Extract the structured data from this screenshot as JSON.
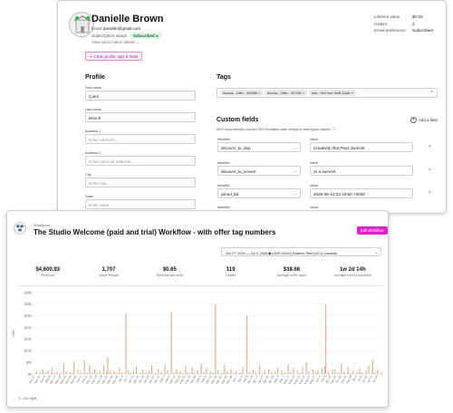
{
  "profile": {
    "name": "Danielle Brown",
    "email_label": "Email",
    "email": "danielle@gmail.com",
    "subscription_label": "Subscription status",
    "subscription_status": "Subscribed",
    "view_details": "View subscription details ⌄",
    "stats": [
      {
        "label": "Lifetime value",
        "value": "$0.00"
      },
      {
        "label": "Orders",
        "value": "2"
      },
      {
        "label": "Email preference",
        "value": "Subscribed"
      }
    ],
    "chip": "✦ Clean profile, tags & fields",
    "profile_title": "Profile",
    "fields": [
      {
        "label": "First name",
        "value": "Cami",
        "placeholder": ""
      },
      {
        "label": "Last name",
        "value": "Dench",
        "placeholder": ""
      },
      {
        "label": "Address 1",
        "value": "",
        "placeholder": "Enter address..."
      },
      {
        "label": "Address 2",
        "value": "",
        "placeholder": "Enter optional address..."
      },
      {
        "label": "City",
        "value": "",
        "placeholder": "Enter city..."
      },
      {
        "label": "State",
        "value": "",
        "placeholder": "Enter state..."
      }
    ],
    "tags_title": "Tags",
    "tags": [
      "Access - Offer - 169988",
      "Access - Offer - 207262",
      "Ads - Sell Your Stuff Guide"
    ],
    "custom_title": "Custom fields",
    "custom_hint": "We'll automatically convert ISO formatted date strings to date-typed values. ⓘ",
    "add_field": "Add a field",
    "identifier_label": "Identifier",
    "value_label": "Value",
    "custom_fields": [
      {
        "identifier": "discover_tu_skip",
        "value": "Creativity that Pays Summit"
      },
      {
        "identifier": "discover_tu_ucreen",
        "value": "At a summit"
      },
      {
        "identifier": "joined_list",
        "value": "2025-06-10 22:19:50 +0000"
      },
      {
        "identifier": "",
        "value": ""
      }
    ]
  },
  "workflow": {
    "breadcrumb": "Workflows",
    "title": "The Studio Welcome (paid and trial) Workflow - with offer tag numbers",
    "edit_button": "Edit Workflow",
    "date_range": "Oct 27, 2024 — Jul 3, 2025   ◆ (GMT-04:00) Eastern Time (US & Canada)",
    "metrics": [
      {
        "value": "$4,600.93",
        "label": "Revenue"
      },
      {
        "value": "1,707",
        "label": "Active People"
      },
      {
        "value": "$0.65",
        "label": "Revenue per send"
      },
      {
        "value": "119",
        "label": "Orders"
      },
      {
        "value": "$38.66",
        "label": "Average order value"
      },
      {
        "value": "1w 2d 14h",
        "label": "Average time to purchase"
      }
    ],
    "footer": "248 days",
    "accent": "#e020c8",
    "bar_color": "#d9a37a"
  },
  "chart_data": {
    "type": "bar",
    "title": "",
    "xlabel": "",
    "ylabel": "USD",
    "ylim": [
      0,
      350
    ],
    "yticks": [
      0,
      50,
      100,
      150,
      200,
      250,
      300,
      350
    ],
    "ytick_labels": [
      "$0",
      "$50",
      "$100",
      "$150",
      "$200",
      "$250",
      "$300",
      "$350"
    ],
    "x_start": "2024-10-27",
    "x_tick_every": 4,
    "grid": true,
    "values": [
      0,
      12,
      0,
      0,
      5,
      0,
      20,
      0,
      8,
      0,
      15,
      0,
      0,
      30,
      0,
      5,
      0,
      10,
      0,
      0,
      6,
      0,
      45,
      0,
      12,
      0,
      0,
      8,
      0,
      4,
      55,
      0,
      0,
      18,
      0,
      9,
      0,
      0,
      60,
      0,
      6,
      0,
      40,
      0,
      10,
      0,
      22,
      0,
      5,
      0,
      12,
      0,
      0,
      35,
      0,
      8,
      70,
      0,
      15,
      0,
      0,
      12,
      0,
      6,
      0,
      25,
      0,
      9,
      0,
      0,
      260,
      0,
      18,
      0,
      6,
      0,
      12,
      0,
      32,
      0,
      0,
      8,
      0,
      20,
      0,
      5,
      0,
      0,
      14,
      0,
      38,
      0,
      0,
      6,
      0,
      22,
      0,
      10,
      0,
      0,
      42,
      0,
      15,
      0,
      0,
      265,
      0,
      8,
      0,
      20,
      0,
      0,
      12,
      0,
      5,
      0,
      35,
      0,
      9,
      0,
      0,
      28,
      0,
      6,
      0,
      15,
      0,
      0,
      44,
      0,
      10,
      0,
      25,
      0,
      0,
      12,
      0,
      6,
      0,
      300,
      0,
      18,
      0,
      0,
      8,
      0,
      40,
      0,
      12,
      0,
      0,
      22,
      0,
      6,
      0,
      14,
      0,
      0,
      9,
      0,
      30,
      0,
      0,
      250,
      0,
      10,
      0,
      0,
      18,
      0,
      8,
      0,
      0,
      36,
      0,
      5,
      0,
      14,
      0,
      0,
      20,
      0,
      7,
      0,
      0,
      12,
      0,
      28,
      0,
      0,
      16,
      0,
      8,
      0,
      0,
      42,
      0,
      10,
      0,
      25,
      0,
      0,
      14,
      0,
      6,
      0,
      30,
      0,
      0,
      50,
      0,
      12,
      0,
      0,
      20,
      0,
      8,
      0,
      15,
      0,
      0,
      25,
      0,
      34,
      300,
      0,
      10,
      0,
      0,
      18,
      0,
      22,
      0,
      0,
      8,
      0,
      45,
      0,
      12,
      0,
      0,
      30,
      0,
      6,
      0,
      16,
      0,
      0,
      10,
      0,
      24,
      0,
      8,
      0,
      0,
      14,
      0,
      36,
      0,
      0,
      62,
      0,
      10,
      0,
      20,
      0,
      0,
      8
    ]
  }
}
